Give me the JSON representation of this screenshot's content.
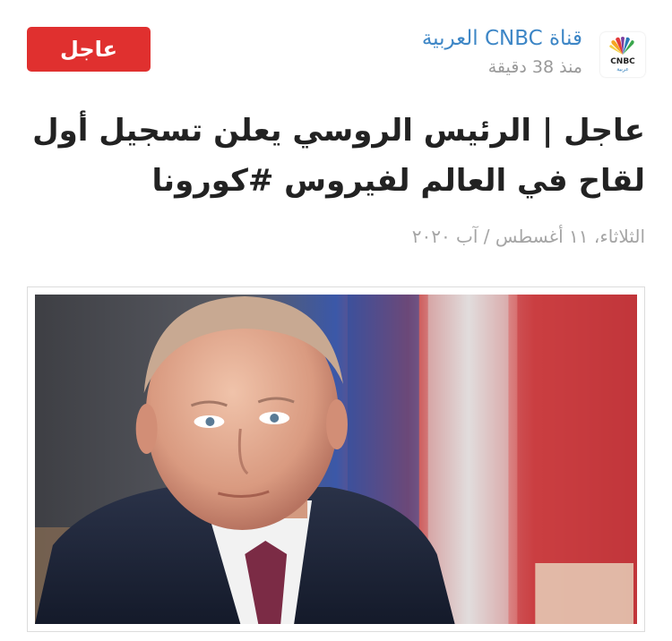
{
  "header": {
    "source_name": "قناة CNBC العربية",
    "time_ago": "منذ 38 دقيقة",
    "badge_label": "عاجل",
    "logo_text": "CNBC",
    "logo_subtext": "عربية"
  },
  "article": {
    "headline": "عاجل | الرئيس الروسي يعلن تسجيل أول لقاح في العالم لفيروس #كورونا",
    "date": "الثلاثاء، ١١ أغسطس / آب ٢٠٢٠"
  },
  "colors": {
    "accent_blue": "#3d86c6",
    "badge_red": "#e0302f",
    "muted_gray": "#9a9a9a"
  }
}
